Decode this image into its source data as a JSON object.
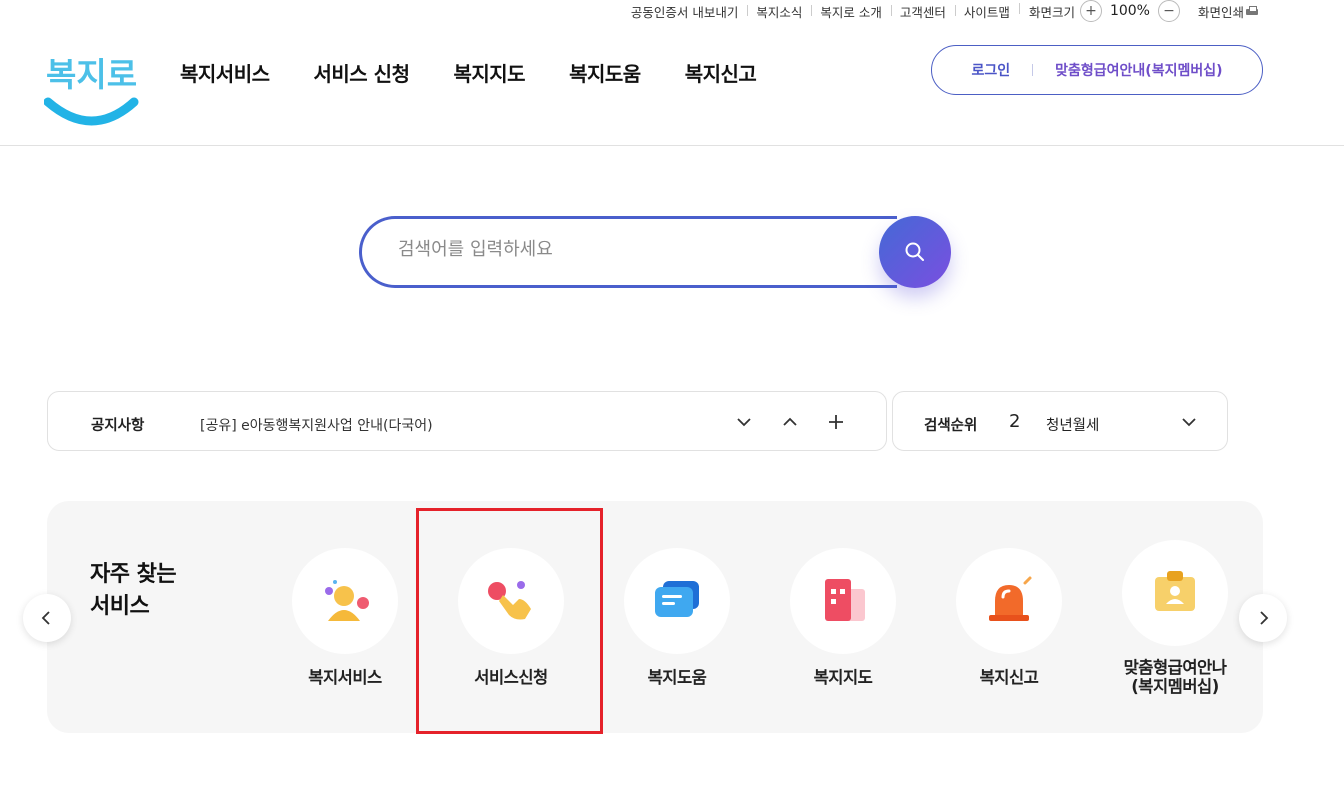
{
  "util": {
    "items": [
      "공동인증서 내보내기",
      "복지소식",
      "복지로 소개",
      "고객센터",
      "사이트맵",
      "화면크기"
    ],
    "zoom_in": "+",
    "zoom_value": "100%",
    "zoom_out": "−",
    "print": "화면인쇄"
  },
  "logo": {
    "text": "복지로"
  },
  "gnb": [
    "복지서비스",
    "서비스 신청",
    "복지지도",
    "복지도움",
    "복지신고"
  ],
  "member": {
    "login": "로그인",
    "membership": "맞춤형급여안내(복지멤버십)"
  },
  "search": {
    "placeholder": "검색어를 입력하세요"
  },
  "notice": {
    "label": "공지사항",
    "text": "[공유] e아동행복지원사업 안내(다국어)"
  },
  "rank": {
    "label": "검색순위",
    "number": "2",
    "keyword": "청년월세"
  },
  "frequent": {
    "title": "자주 찾는\n서비스",
    "items": [
      {
        "label": "복지서비스",
        "icon": "person-icon"
      },
      {
        "label": "서비스신청",
        "icon": "hand-pointer-icon"
      },
      {
        "label": "복지도움",
        "icon": "chat-bubble-icon"
      },
      {
        "label": "복지지도",
        "icon": "map-building-icon"
      },
      {
        "label": "복지신고",
        "icon": "siren-icon"
      },
      {
        "label": "맞춤형급여안나\n(복지멤버십)",
        "icon": "id-badge-icon"
      }
    ]
  },
  "colors": {
    "accent": "#4a5fcc",
    "accent_purple": "#7a4fe0",
    "highlight": "#e5222a"
  }
}
